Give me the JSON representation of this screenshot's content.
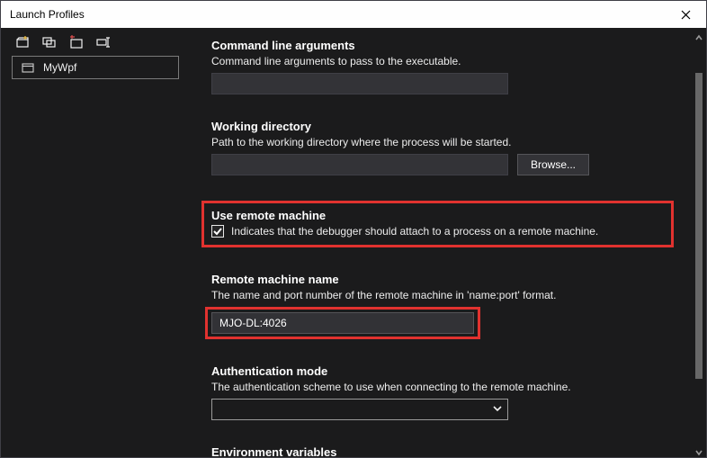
{
  "titlebar": {
    "title": "Launch Profiles"
  },
  "profiles": {
    "selected_label": "MyWpf"
  },
  "sections": {
    "cli": {
      "title": "Command line arguments",
      "desc": "Command line arguments to pass to the executable.",
      "value": ""
    },
    "wd": {
      "title": "Working directory",
      "desc": "Path to the working directory where the process will be started.",
      "value": "",
      "browse_label": "Browse..."
    },
    "remote": {
      "title": "Use remote machine",
      "desc": "Indicates that the debugger should attach to a process on a remote machine.",
      "checked": true
    },
    "remote_name": {
      "title": "Remote machine name",
      "desc": "The name and port number of the remote machine in 'name:port' format.",
      "value": "MJO-DL:4026"
    },
    "auth": {
      "title": "Authentication mode",
      "desc": "The authentication scheme to use when connecting to the remote machine.",
      "value": ""
    },
    "env": {
      "title": "Environment variables"
    }
  }
}
